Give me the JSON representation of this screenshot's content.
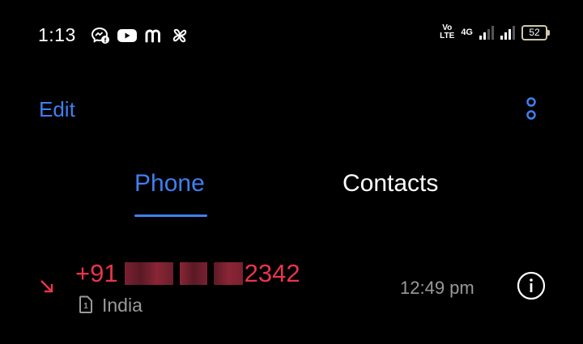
{
  "status_bar": {
    "time": "1:13",
    "notification_icons": [
      "messenger-icon",
      "youtube-icon",
      "meesho-icon",
      "pinwheel-icon"
    ],
    "volte_line1": "Vo",
    "volte_line2": "LTE",
    "network_type": "4G",
    "battery_level": "52"
  },
  "toolbar": {
    "edit_label": "Edit",
    "more_icon": "more-vertical-icon"
  },
  "tabs": [
    {
      "label": "Phone",
      "active": true
    },
    {
      "label": "Contacts",
      "active": false
    }
  ],
  "call_log": [
    {
      "number_prefix": "+91",
      "number_tail": "2342",
      "sim_label": "1",
      "location": "India",
      "time": "12:49 pm",
      "direction_icon": "missed-call-arrow-icon",
      "info_icon": "info-icon"
    }
  ],
  "colors": {
    "accent": "#3f7ff0",
    "missed_call": "#e8354a",
    "secondary_text": "#9a9a9a",
    "background": "#000000"
  }
}
